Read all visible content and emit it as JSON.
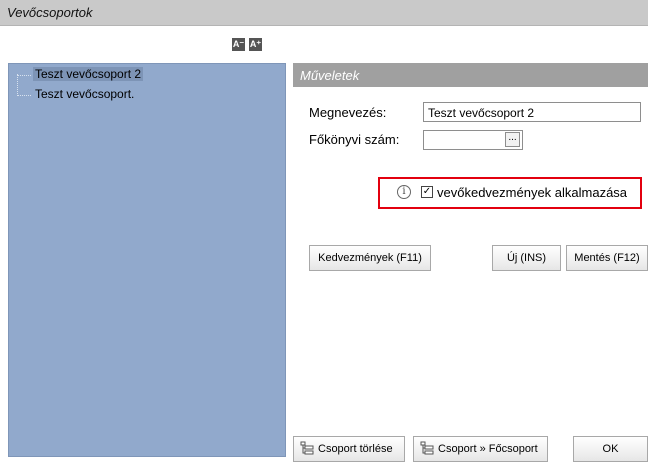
{
  "window": {
    "title": "Vevőcsoportok"
  },
  "tree_toolbar": {
    "collapse_label": "A⁻",
    "expand_label": "A⁺"
  },
  "tree": {
    "items": [
      {
        "label": "Teszt vevőcsoport 2",
        "selected": true
      },
      {
        "label": "Teszt vevőcsoport.",
        "selected": false
      }
    ]
  },
  "operations": {
    "header": "Műveletek",
    "name_label": "Megnevezés:",
    "name_value": "Teszt vevőcsoport 2",
    "ledger_label": "Főkönyvi szám:",
    "ledger_value": "",
    "ledger_button": "...",
    "checkbox_label": "vevőkedvezmények alkalmazása",
    "checkbox_checked": true,
    "info_symbol": "i"
  },
  "buttons": {
    "discounts": "Kedvezmények (F11)",
    "new": "Új (INS)",
    "save": "Mentés (F12)",
    "delete_group": "Csoport törlése",
    "main_group": "Csoport » Főcsoport",
    "ok": "OK"
  },
  "colors": {
    "tree_bg": "#91a9cc",
    "highlight": "#e3000f",
    "header_bg": "#a0a0a0"
  }
}
